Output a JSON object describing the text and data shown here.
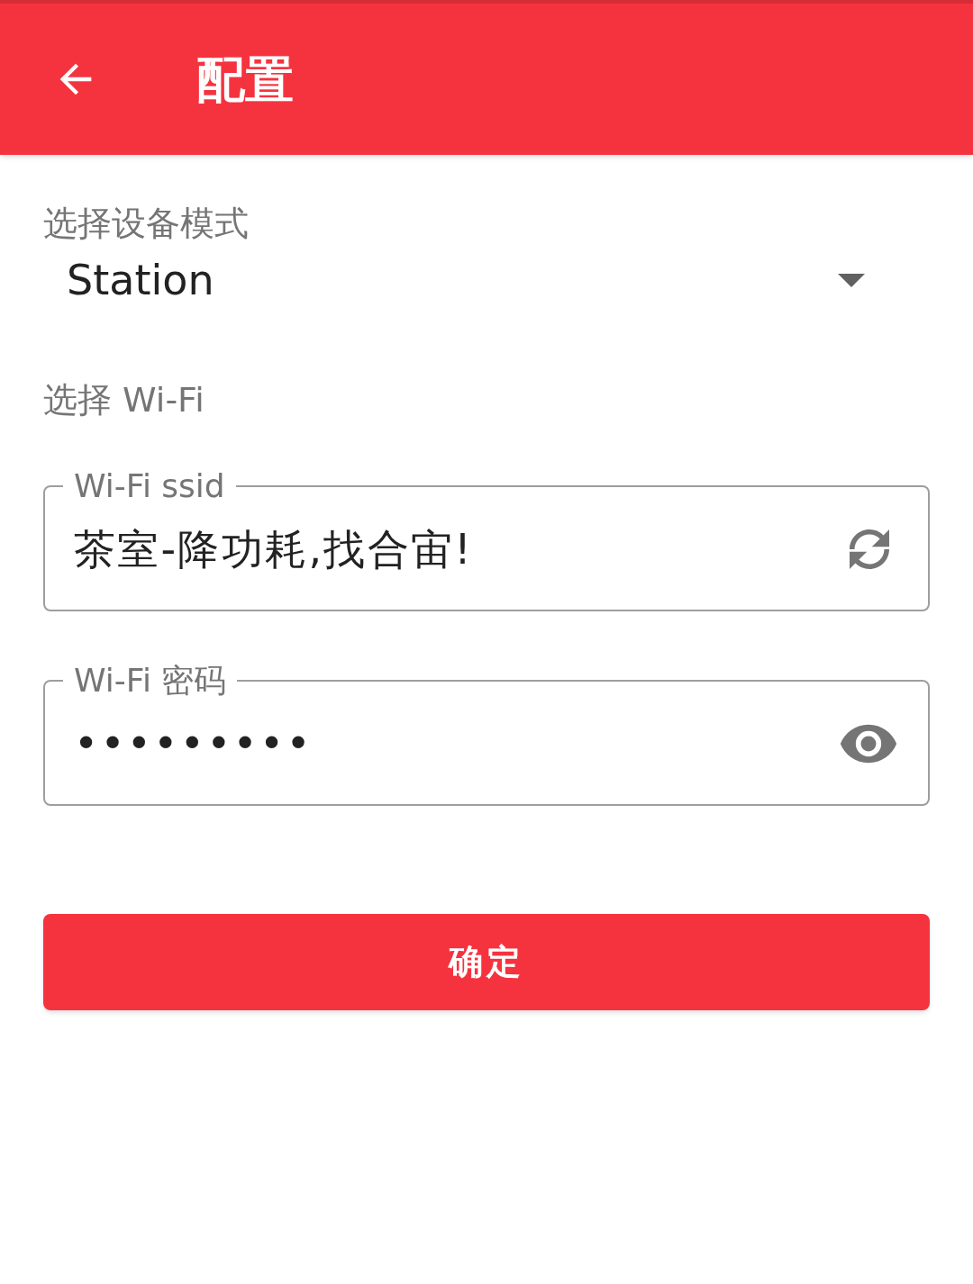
{
  "app_bar": {
    "title": "配置"
  },
  "mode": {
    "label": "选择设备模式",
    "value": "Station"
  },
  "wifi_section": {
    "label": "选择 Wi-Fi"
  },
  "ssid_field": {
    "label": "Wi-Fi ssid",
    "value": "茶室-降功耗,找合宙!"
  },
  "password_field": {
    "label": "Wi-Fi 密码",
    "value": "•••••••••"
  },
  "confirm_button": {
    "label": "确定"
  }
}
